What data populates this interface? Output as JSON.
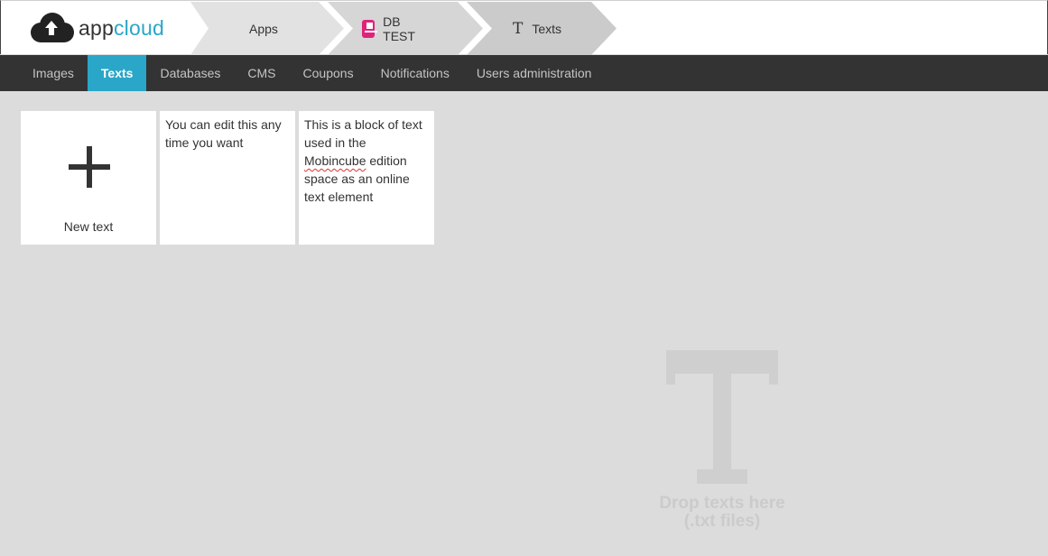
{
  "header": {
    "logo": {
      "app": "app",
      "cloud": "cloud"
    },
    "breadcrumbs": {
      "apps": "Apps",
      "db": "DB TEST",
      "texts": "Texts"
    }
  },
  "nav": {
    "items": [
      "Images",
      "Texts",
      "Databases",
      "CMS",
      "Coupons",
      "Notifications",
      "Users administration"
    ],
    "active": "Texts"
  },
  "cards": {
    "new_label": "New text",
    "items": [
      {
        "lines": [
          "You can edit this any",
          "time you want"
        ]
      },
      {
        "lines": [
          "This is a block of text",
          "used in the",
          "Mobincube",
          "edition",
          "space as an online",
          "text element"
        ]
      }
    ]
  },
  "drop_zone": {
    "line1": "Drop texts here",
    "line2": "(.txt files)"
  },
  "colors": {
    "accent": "#2aa6c8",
    "nav_bg": "#333333",
    "page_bg": "#dcdcdc",
    "db_icon": "#e0237a"
  }
}
